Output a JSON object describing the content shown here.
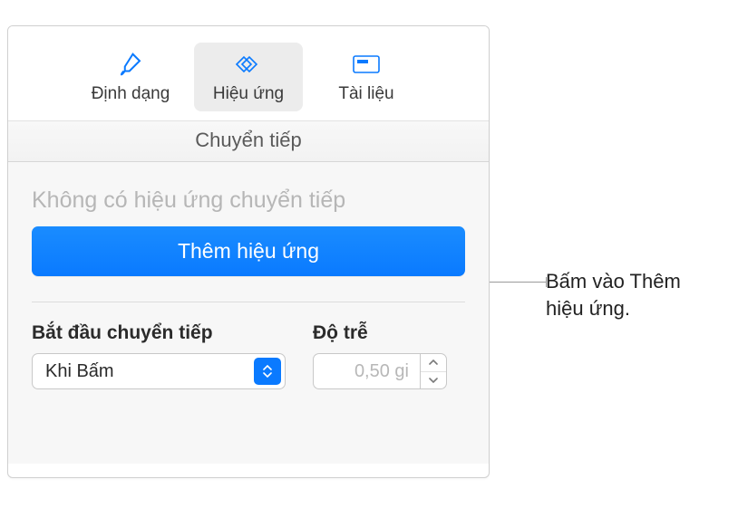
{
  "toolbar": {
    "format_label": "Định dạng",
    "animate_label": "Hiệu ứng",
    "document_label": "Tài liệu"
  },
  "subheader": "Chuyển tiếp",
  "main": {
    "no_effect_text": "Không có hiệu ứng chuyển tiếp",
    "add_button_label": "Thêm hiệu ứng",
    "start_label": "Bắt đầu chuyển tiếp",
    "start_value": "Khi Bấm",
    "delay_label": "Độ trễ",
    "delay_value": "0,50 gi"
  },
  "callout": {
    "line1": "Bấm vào Thêm",
    "line2": "hiệu ứng."
  }
}
